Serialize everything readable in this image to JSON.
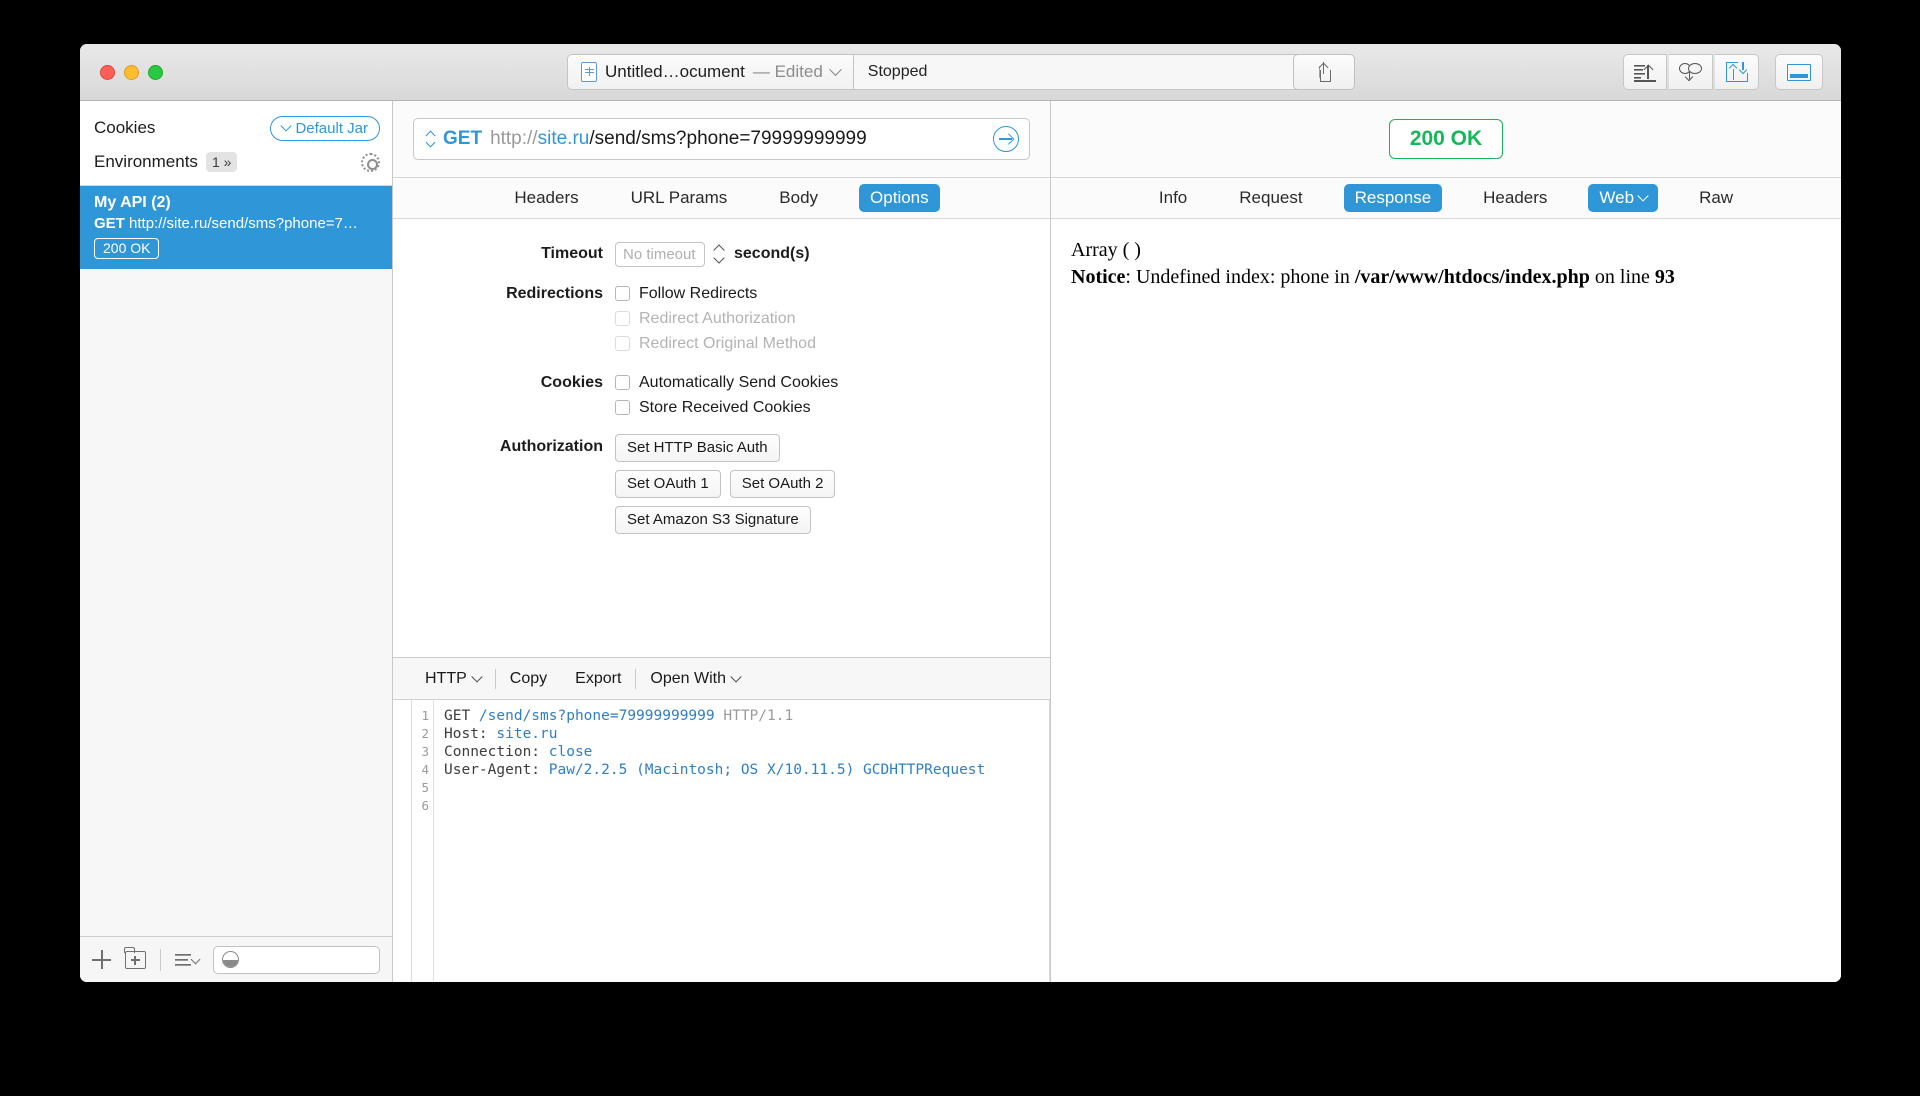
{
  "window": {
    "traffic_lights": [
      "close",
      "minimize",
      "zoom"
    ],
    "title": {
      "document_name": "Untitled…ocument",
      "edited_label": "— Edited",
      "dropdown_icon": "chevron-down-icon",
      "doc_icon": "paw-document-icon"
    },
    "status_field": "Stopped",
    "share_icon": "share-icon",
    "right_tools": [
      {
        "name": "sort-ascending-icon",
        "label": "sort"
      },
      {
        "name": "cloud-sync-icon",
        "label": "cloud"
      },
      {
        "name": "import-export-icon",
        "label": "import"
      },
      {
        "name": "toggle-bottom-panel-icon",
        "label": "panel"
      }
    ]
  },
  "sidebar": {
    "cookies_label": "Cookies",
    "cookies_jar_button": "Default Jar",
    "environments_label": "Environments",
    "environments_count": "1 »",
    "gear_icon": "gear-icon",
    "request": {
      "name": "My API (2)",
      "method": "GET",
      "url": "http://site.ru/send/sms?phone=7…",
      "status": "200 OK"
    },
    "footer": {
      "add_icon": "plus-icon",
      "new_folder_icon": "new-folder-icon",
      "sort_icon": "list-sort-icon",
      "filter_icon": "filter-icon",
      "search_placeholder": "",
      "search_value": ""
    }
  },
  "request_pane": {
    "url_bar": {
      "method_switch_icon": "up-down-arrows-icon",
      "method": "GET",
      "url_scheme": "http://",
      "url_host": "site.ru",
      "url_path": "/send/sms?phone=79999999999",
      "send_icon": "send-arrow-icon"
    },
    "tabs": [
      {
        "label": "Headers",
        "active": false
      },
      {
        "label": "URL Params",
        "active": false
      },
      {
        "label": "Body",
        "active": false
      },
      {
        "label": "Options",
        "active": true
      }
    ],
    "options": {
      "timeout_label": "Timeout",
      "timeout_placeholder": "No timeout",
      "timeout_value": "",
      "timeout_unit": "second(s)",
      "redirections_label": "Redirections",
      "redirections": [
        {
          "label": "Follow Redirects",
          "checked": false,
          "disabled": false
        },
        {
          "label": "Redirect Authorization",
          "checked": false,
          "disabled": true
        },
        {
          "label": "Redirect Original Method",
          "checked": false,
          "disabled": true
        }
      ],
      "cookies_label": "Cookies",
      "cookies": [
        {
          "label": "Automatically Send Cookies",
          "checked": false,
          "disabled": false
        },
        {
          "label": "Store Received Cookies",
          "checked": false,
          "disabled": false
        }
      ],
      "authorization_label": "Authorization",
      "auth_buttons_row1": [
        "Set HTTP Basic Auth"
      ],
      "auth_buttons_row2": [
        "Set OAuth 1",
        "Set OAuth 2"
      ],
      "auth_buttons_row3": [
        "Set Amazon S3 Signature"
      ]
    },
    "code_toolbar": {
      "format": "HTTP",
      "copy": "Copy",
      "export": "Export",
      "open_with": "Open With"
    },
    "code": {
      "line_numbers": [
        "1",
        "2",
        "3",
        "4",
        "5",
        "6"
      ],
      "lines": [
        {
          "parts": [
            {
              "t": "GET ",
              "c": "dark"
            },
            {
              "t": "/send/sms?phone=79999999999",
              "c": "blue"
            },
            {
              "t": " HTTP/1.1",
              "c": "gray"
            }
          ]
        },
        {
          "parts": [
            {
              "t": "Host: ",
              "c": "dark"
            },
            {
              "t": "site.ru",
              "c": "blue"
            }
          ]
        },
        {
          "parts": [
            {
              "t": "Connection: ",
              "c": "dark"
            },
            {
              "t": "close",
              "c": "blue"
            }
          ]
        },
        {
          "parts": [
            {
              "t": "User-Agent: ",
              "c": "dark"
            },
            {
              "t": "Paw/2.2.5 (Macintosh; OS X/10.11.5) GCDHTTPRequest",
              "c": "blue"
            }
          ]
        },
        {
          "parts": []
        },
        {
          "parts": []
        }
      ]
    }
  },
  "response_pane": {
    "status_badge": "200 OK",
    "tabs": [
      {
        "label": "Info",
        "active": false
      },
      {
        "label": "Request",
        "active": false
      },
      {
        "label": "Response",
        "active": true
      },
      {
        "label": "Headers",
        "active": false
      },
      {
        "label": "Web",
        "active": true,
        "dropdown": true
      },
      {
        "label": "Raw",
        "active": false
      }
    ],
    "body": {
      "line1": "Array ( )",
      "notice_label": "Notice",
      "notice_sep": ": Undefined index: phone in ",
      "notice_path": "/var/www/htdocs/index.php",
      "notice_tail": " on line ",
      "notice_line": "93"
    }
  },
  "colors": {
    "accent_blue": "#2f97d8",
    "success_green": "#15b858",
    "window_chrome": "#e4e4e4"
  }
}
